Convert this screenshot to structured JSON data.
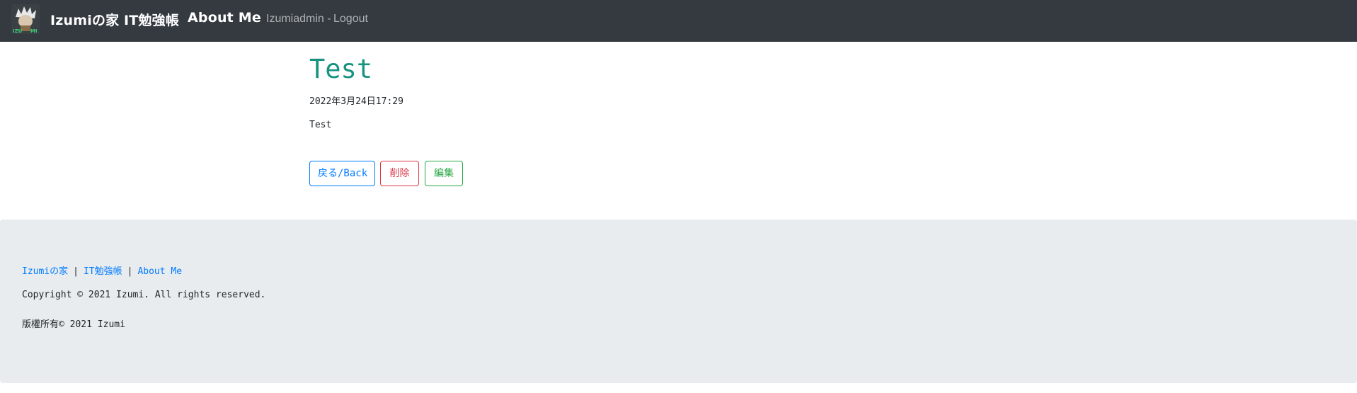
{
  "navbar": {
    "brand_home": "Izumiの家",
    "brand_it": "IT勉強帳",
    "brand_about": "About Me",
    "user": "Izumiadmin - ",
    "logout": "Logout",
    "logo_text": "IZU MI"
  },
  "post": {
    "title": "Test",
    "date": "2022年3月24日17:29",
    "body": "Test"
  },
  "actions": {
    "back_label": "戻る/Back",
    "delete_label": "削除",
    "edit_label": "編集"
  },
  "footer": {
    "link_home": "Izumiの家",
    "link_it": "IT勉強帳",
    "link_about": "About Me",
    "separator": "|",
    "copyright": "Copyright © 2021 Izumi. All rights reserved.",
    "rights_jp": "版權所有© 2021 Izumi"
  },
  "colors": {
    "navbar_bg": "#343a40",
    "title": "#17947f",
    "primary": "#007bff",
    "danger": "#dc3545",
    "success": "#28a745",
    "footer_bg": "#e9ecef"
  }
}
